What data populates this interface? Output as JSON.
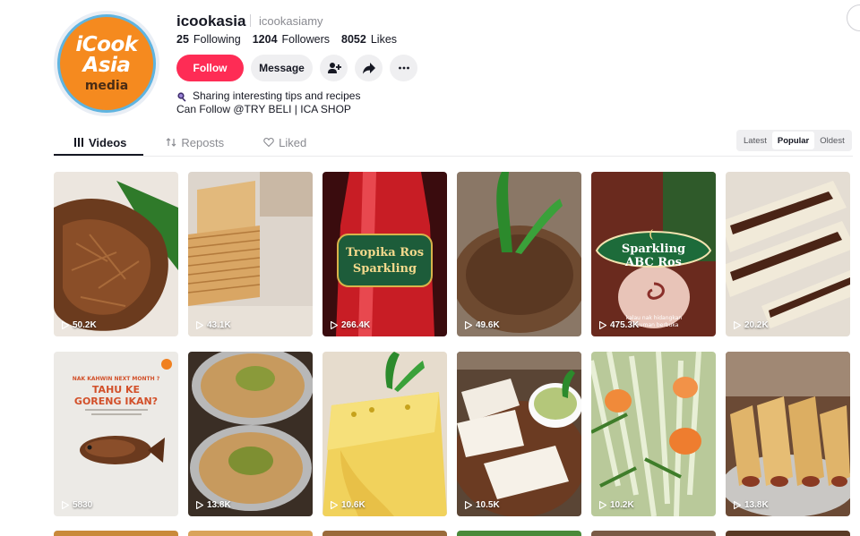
{
  "profile": {
    "username": "icookasia",
    "nickname": "icookasiamy",
    "avatar_logo": {
      "line1": "iCook",
      "line2": "Asia",
      "line3": "media"
    },
    "stats": [
      {
        "value": "25",
        "label": "Following"
      },
      {
        "value": "1204",
        "label": "Followers"
      },
      {
        "value": "8052",
        "label": "Likes"
      }
    ],
    "buttons": {
      "follow": "Follow",
      "message": "Message"
    },
    "icons": {
      "add_friend": "person-plus-icon",
      "share": "share-arrow-icon",
      "more": "more-dots-icon",
      "bio": "magnifier-icon"
    },
    "bio_line1": "Sharing interesting tips and recipes",
    "bio_line2": "Can Follow @TRY BELI | ICA SHOP"
  },
  "tabs": [
    {
      "label": "Videos",
      "icon": "grid-icon",
      "active": true
    },
    {
      "label": "Reposts",
      "icon": "repost-icon",
      "active": false
    },
    {
      "label": "Liked",
      "icon": "heart-icon",
      "active": false
    }
  ],
  "sort": {
    "options": [
      "Latest",
      "Popular",
      "Oldest"
    ],
    "selected": "Popular"
  },
  "colors": {
    "accent": "#fe2c55",
    "avatar_bg": "#f58a1f",
    "avatar_ring": "#5fb4e0"
  },
  "videos": [
    {
      "views": "50.2K",
      "thumb": "shredded-meat-floss"
    },
    {
      "views": "43.1K",
      "thumb": "layered-wafers"
    },
    {
      "views": "266.4K",
      "thumb": "tropika-ros-sparkling",
      "overlay_line1": "Tropika Ros",
      "overlay_line2": "Sparkling"
    },
    {
      "views": "49.6K",
      "thumb": "pandan-dessert"
    },
    {
      "views": "475.3K",
      "thumb": "sparkling-abc-ros",
      "overlay_line1": "Sparkling",
      "overlay_line2": "ABC Ros",
      "overlay_caption": "kalau nak hidangkan",
      "overlay_caption2": "kuman berbuka"
    },
    {
      "views": "20.2K",
      "thumb": "chocolate-crepe-rolls"
    },
    {
      "views": "5830",
      "thumb": "fried-fish-poster",
      "overlay_line1": "NAK KAHWIN NEXT MONTH ?",
      "overlay_line2": "TAHU KE",
      "overlay_line3": "GORENG IKAN?"
    },
    {
      "views": "13.8K",
      "thumb": "pistachio-tarts"
    },
    {
      "views": "10.6K",
      "thumb": "custard-pudding"
    },
    {
      "views": "10.5K",
      "thumb": "bread-with-kaya"
    },
    {
      "views": "10.2K",
      "thumb": "shrimp-salad"
    },
    {
      "views": "13.8K",
      "thumb": "spring-rolls"
    }
  ]
}
